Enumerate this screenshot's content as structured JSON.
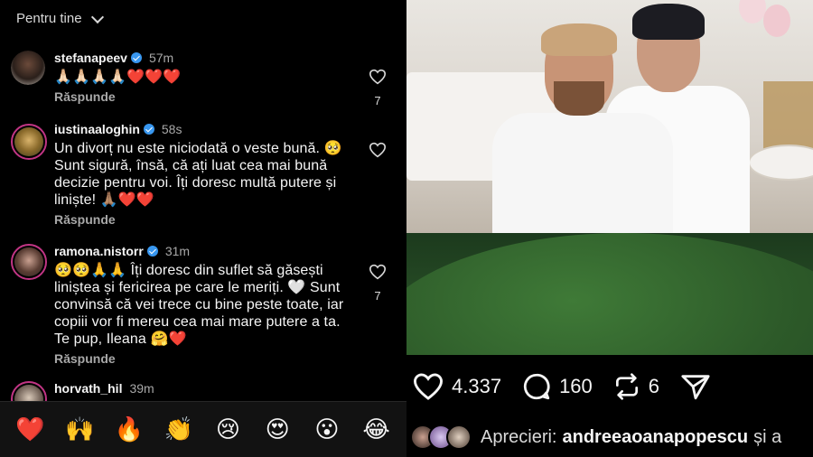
{
  "header": {
    "title": "Pentru tine"
  },
  "comments": [
    {
      "username": "stefanapeev",
      "time": "57m",
      "text": "🙏🏻🙏🏻🙏🏻🙏🏻❤️❤️❤️",
      "reply": "Răspunde",
      "likes": "7"
    },
    {
      "username": "iustinaaloghin",
      "time": "58s",
      "text": "Un divorț nu este niciodată o veste bună. 🥺 Sunt sigură, însă, că ați luat cea mai bună decizie pentru voi. Îți doresc multă putere și liniște! 🙏🏽❤️❤️",
      "reply": "Răspunde",
      "likes": ""
    },
    {
      "username": "ramona.nistorr",
      "time": "31m",
      "text": "🥺🥺🙏🙏 Îți doresc din suflet să găsești liniștea și fericirea pe care le meriți. 🤍 Sunt convinsă că vei trece cu bine peste toate, iar copiii vor fi mereu cea mai mare putere a ta. Te pup, Ileana 🤗❤️",
      "reply": "Răspunde",
      "likes": "7"
    },
    {
      "username": "horvath_hil",
      "time": "39m",
      "text": "",
      "reply": "",
      "likes": ""
    }
  ],
  "emoji_bar": [
    "❤️",
    "🙌",
    "🔥",
    "👏",
    "😢",
    "😍",
    "😮",
    "😂"
  ],
  "post": {
    "likes": "4.337",
    "comments": "160",
    "reposts": "6",
    "likes_label": "Aprecieri:",
    "liked_by": "andreeaoanapopescu",
    "and_text": "și a"
  },
  "colors": {
    "verified": "#3897f0",
    "story_ring": "#c13584",
    "background": "#000000"
  }
}
